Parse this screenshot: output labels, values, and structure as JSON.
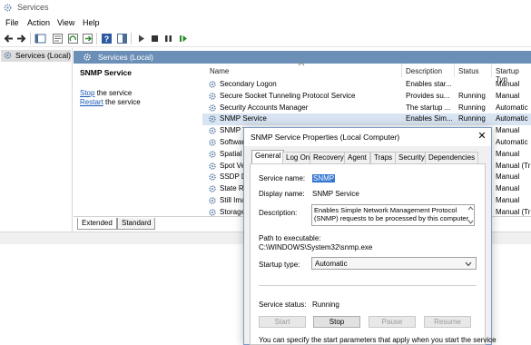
{
  "window": {
    "title": "Services"
  },
  "menu": [
    "File",
    "Action",
    "View",
    "Help"
  ],
  "toolbar_icons": [
    "back-arrow-icon",
    "forward-arrow-icon",
    "console-tree-icon",
    "properties-icon",
    "refresh-icon",
    "export-icon",
    "help-icon",
    "show-hide-icon",
    "play-icon",
    "stop-icon",
    "pause-icon",
    "restart-icon"
  ],
  "tree": {
    "node_label": "Services (Local)"
  },
  "header": {
    "label": "Services (Local)"
  },
  "desc": {
    "service_name": "SNMP Service",
    "stop_link": "Stop",
    "stop_suffix": " the service",
    "restart_link": "Restart",
    "restart_suffix": " the service"
  },
  "columns": {
    "name": "Name",
    "description": "Description",
    "status": "Status",
    "startup": "Startup Typ"
  },
  "rows": [
    {
      "name": "Secondary Logon",
      "description": "Enables star...",
      "status": "",
      "startup": "Manual"
    },
    {
      "name": "Secure Socket Tunneling Protocol Service",
      "description": "Provides su...",
      "status": "Running",
      "startup": "Manual"
    },
    {
      "name": "Security Accounts Manager",
      "description": "The startup ...",
      "status": "Running",
      "startup": "Automatic"
    },
    {
      "name": "SNMP Service",
      "description": "Enables Sim...",
      "status": "Running",
      "startup": "Automatic"
    },
    {
      "name": "SNMP T",
      "description": "",
      "status": "",
      "startup": "Manual"
    },
    {
      "name": "Softwar",
      "description": "",
      "status": "",
      "startup": "Automatic"
    },
    {
      "name": "Spatial D",
      "description": "",
      "status": "",
      "startup": "Manual"
    },
    {
      "name": "Spot Ver",
      "description": "",
      "status": "",
      "startup": "Manual (Tr"
    },
    {
      "name": "SSDP Di",
      "description": "",
      "status": "",
      "startup": "Manual"
    },
    {
      "name": "State Re",
      "description": "",
      "status": "",
      "startup": "Manual"
    },
    {
      "name": "Still Ima",
      "description": "",
      "status": "",
      "startup": "Manual"
    },
    {
      "name": "Storage",
      "description": "",
      "status": "",
      "startup": "Manual (Tr"
    }
  ],
  "bottom_tabs": [
    "Extended",
    "Standard"
  ],
  "dialog": {
    "title": "SNMP Service Properties (Local Computer)",
    "close": "✕",
    "tabs": [
      "General",
      "Log On",
      "Recovery",
      "Agent",
      "Traps",
      "Security",
      "Dependencies"
    ],
    "service_name_label": "Service name:",
    "service_name": "SNMP",
    "display_name_label": "Display name:",
    "display_name": "SNMP Service",
    "description_label": "Description:",
    "description": "Enables Simple Network Management Protocol (SNMP) requests to be processed by this computer.",
    "path_label": "Path to executable:",
    "path": "C:\\WINDOWS\\System32\\snmp.exe",
    "startup_label": "Startup type:",
    "startup_value": "Automatic",
    "status_label": "Service status:",
    "status_value": "Running",
    "buttons": {
      "start": "Start",
      "stop": "Stop",
      "pause": "Pause",
      "resume": "Resume"
    },
    "footer": "You can specify the start parameters that apply when you start the service"
  },
  "colors": {
    "header_blue": "#6b8fb6",
    "selection": "#d9e4f2",
    "link": "#1a56b6",
    "highlight": "#3477d3"
  }
}
